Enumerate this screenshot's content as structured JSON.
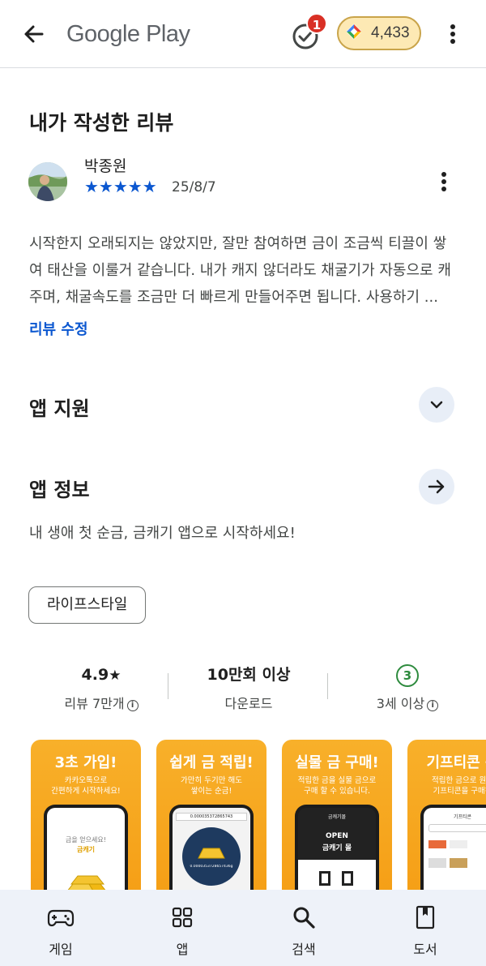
{
  "topbar": {
    "logo_text": "Google Play",
    "notification_count": "1",
    "points": "4,433"
  },
  "review_section": {
    "title": "내가 작성한 리뷰",
    "reviewer_name": "박종원",
    "stars": "★★★★★",
    "rating": 5,
    "date": "25/8/7",
    "text": "시작한지 오래되지는 않았지만, 잘만 참여하면 금이 조금씩 티끌이 쌓여 태산을 이룰거 같습니다. 내가 캐지 않더라도 채굴기가 자동으로 캐주며, 채굴속도를 조금만 더 빠르게 만들어주면 됩니다. 사용하기 ...",
    "edit_label": "리뷰 수정"
  },
  "support_section": {
    "title": "앱 지원"
  },
  "about_section": {
    "title": "앱 정보",
    "description": "내 생애 첫 순금, 금캐기 앱으로 시작하세요!",
    "category": "라이프스타일"
  },
  "stats": {
    "rating": "4.9",
    "reviews_label": "리뷰 7만개",
    "downloads": "10만회 이상",
    "downloads_label": "다운로드",
    "age_badge": "3",
    "age_label": "3세 이상"
  },
  "screenshots": [
    {
      "title": "3초 가입!",
      "subtitle": "카카오톡으로\n간편하게 시작하세요!",
      "screen_lines": [
        "금을 얻으세요!",
        "금캐기"
      ]
    },
    {
      "title": "쉽게 금 적립!",
      "subtitle": "가만히 두기만 해도\n쌓이는 순금!",
      "screen_lines": [
        "0.000035372865743",
        "0.0000353728657436g"
      ]
    },
    {
      "title": "실물 금 구매!",
      "subtitle": "적립한 금을 실물 금으로\n구매 할 수 있습니다.",
      "screen_lines": [
        "금캐기몰",
        "OPEN",
        "금캐기 몰"
      ]
    },
    {
      "title": "기프티콘 구",
      "subtitle": "적립한 금으로 원하\n기프티콘을 구매하",
      "screen_lines": [
        "기프티콘"
      ]
    }
  ],
  "bottom_nav": [
    {
      "label": "게임",
      "icon": "gamepad-icon"
    },
    {
      "label": "앱",
      "icon": "apps-grid-icon"
    },
    {
      "label": "검색",
      "icon": "search-icon"
    },
    {
      "label": "도서",
      "icon": "book-icon"
    }
  ],
  "colors": {
    "accent_blue": "#0b57d0",
    "star_blue": "#0b57d0",
    "badge_red": "#d93025",
    "screenshot_orange": "#f7a81f",
    "nav_bg": "#eef2f9"
  }
}
